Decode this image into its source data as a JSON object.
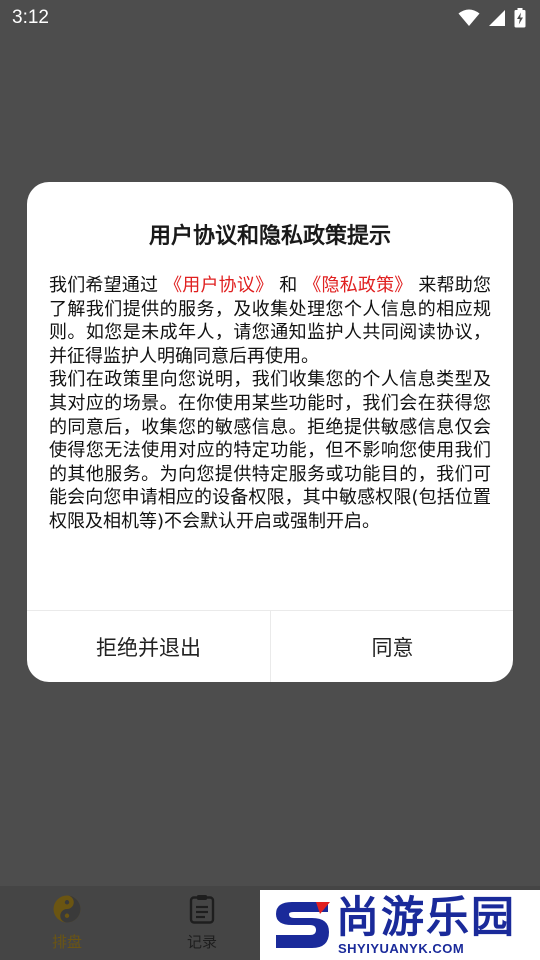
{
  "status_bar": {
    "time": "3:12",
    "icons": [
      "wifi-icon",
      "signal-icon",
      "battery-charging-icon"
    ]
  },
  "dialog": {
    "title": "用户协议和隐私政策提示",
    "body": {
      "p1_prefix": "我们希望通过",
      "user_agreement_link": "《用户协议》",
      "p1_and": "和",
      "privacy_policy_link": "《隐私政策》",
      "p1_suffix": "来帮助您了解我们提供的服务，及收集处理您个人信息的相应规则。如您是未成年人，请您通知监护人共同阅读协议，并征得监护人明确同意后再使用。",
      "p2": "我们在政策里向您说明，我们收集您的个人信息类型及其对应的场景。在你使用某些功能时，我们会在获得您的同意后，收集您的敏感信息。拒绝提供敏感信息仅会使得您无法使用对应的特定功能，但不影响您使用我们的其他服务。为向您提供特定服务或功能目的，我们可能会向您申请相应的设备权限，其中敏感权限(包括位置权限及相机等)不会默认开启或强制开启。"
    },
    "reject_label": "拒绝并退出",
    "agree_label": "同意",
    "link_color": "#e02020"
  },
  "bottom_nav": {
    "items": [
      {
        "label": "排盘",
        "icon": "yin-yang-icon",
        "active": true
      },
      {
        "label": "记录",
        "icon": "clipboard-icon",
        "active": false
      }
    ],
    "active_color": "#6b5512"
  },
  "watermark": {
    "brand": "尚游乐园",
    "url": "SHYIYUANYK.COM",
    "color": "#1a2a9a"
  }
}
